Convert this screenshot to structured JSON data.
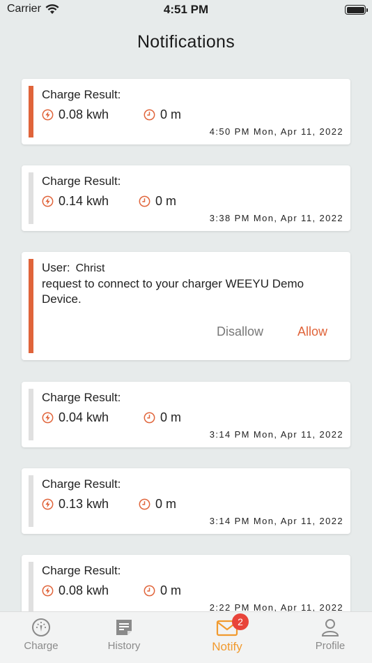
{
  "status": {
    "carrier": "Carrier",
    "time": "4:51 PM"
  },
  "page_title": "Notifications",
  "notifications": [
    {
      "heading": "Charge Result:",
      "energy": "0.08 kwh",
      "duration": "0 m",
      "timestamp": "4:50 PM Mon, Apr 11, 2022"
    },
    {
      "heading": "Charge Result:",
      "energy": "0.14 kwh",
      "duration": "0 m",
      "timestamp": "3:38 PM Mon, Apr 11, 2022"
    },
    {
      "heading": "Charge Result:",
      "energy": "0.04 kwh",
      "duration": "0 m",
      "timestamp": "3:14 PM Mon, Apr 11, 2022"
    },
    {
      "heading": "Charge Result:",
      "energy": "0.13 kwh",
      "duration": "0 m",
      "timestamp": "3:14 PM Mon, Apr 11, 2022"
    },
    {
      "heading": "Charge Result:",
      "energy": "0.08 kwh",
      "duration": "0 m",
      "timestamp": "2:22 PM Mon, Apr 11, 2022"
    }
  ],
  "request": {
    "user_label": "User:",
    "user_name": "Christ",
    "message": "request to connect to your charger WEEYU Demo Device.",
    "disallow_label": "Disallow",
    "allow_label": "Allow"
  },
  "tabs": [
    {
      "label": "Charge"
    },
    {
      "label": "History"
    },
    {
      "label": "Notify",
      "badge": "2"
    },
    {
      "label": "Profile"
    }
  ],
  "colors": {
    "accent": "#e0643a",
    "active_tab": "#f19a2e",
    "badge": "#e8443a"
  }
}
